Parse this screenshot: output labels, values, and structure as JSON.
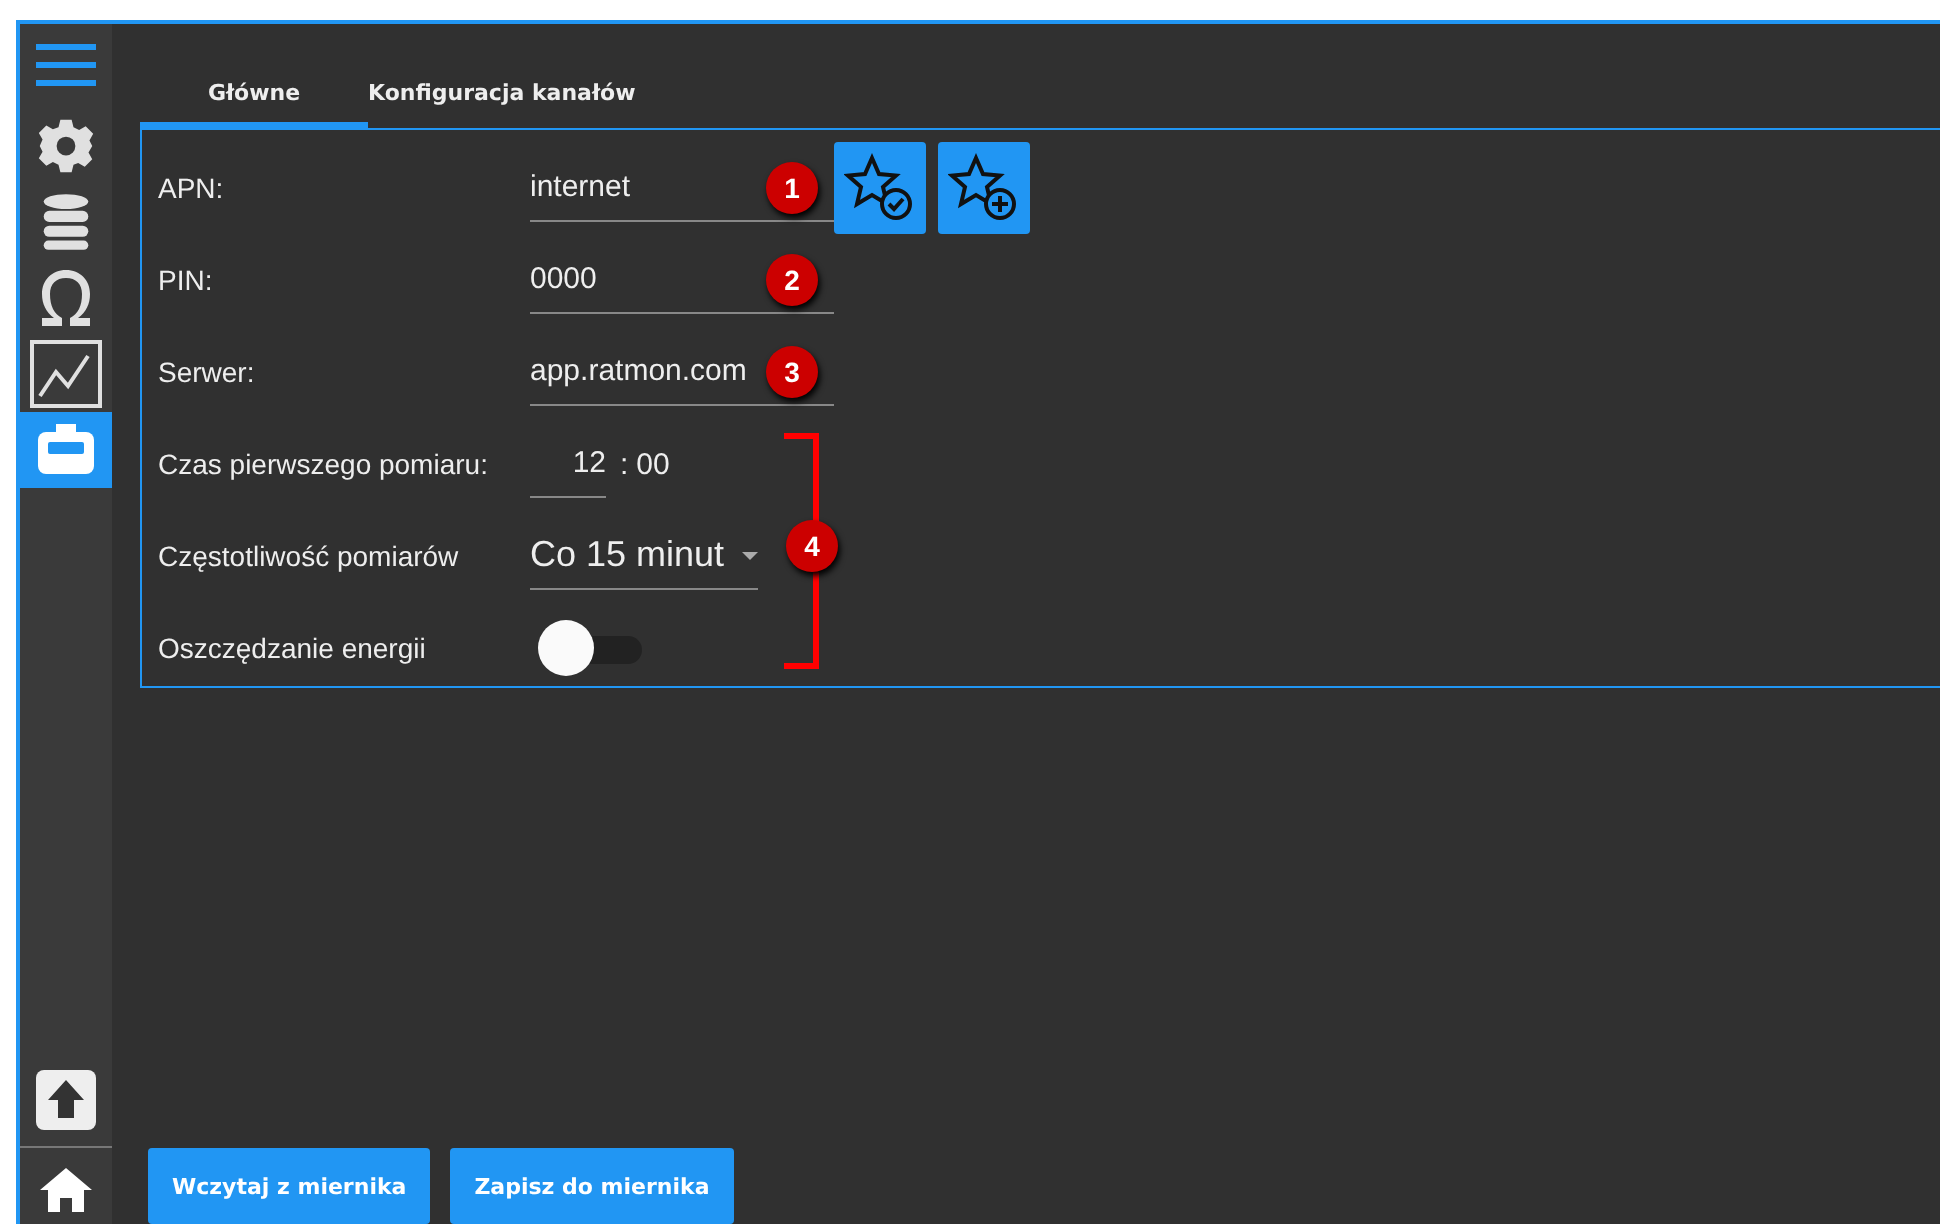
{
  "sidebar": {
    "items": [
      {
        "selected": false
      },
      {
        "selected": false
      },
      {
        "selected": false
      },
      {
        "selected": false
      },
      {
        "selected": true
      }
    ]
  },
  "tabs": [
    {
      "label": "Główne",
      "selected": true
    },
    {
      "label": "Konfiguracja kanałów",
      "selected": false
    }
  ],
  "fields": [
    {
      "kind": "text",
      "label": "APN:",
      "value": "internet",
      "badge": "1"
    },
    {
      "kind": "text",
      "label": "PIN:",
      "value": "0000",
      "badge": "2"
    },
    {
      "kind": "text",
      "label": "Serwer:",
      "value": "app.ratmon.com",
      "badge": "3"
    },
    {
      "kind": "time",
      "label": "Czas pierwszego pomiaru:",
      "hours": "12",
      "separator": ":",
      "minutes": "00"
    },
    {
      "kind": "select",
      "label": "Częstotliwość pomiarów",
      "value": "Co 15 minut"
    },
    {
      "kind": "toggle",
      "label": "Oszczędzanie energii",
      "on": false
    }
  ],
  "group_badge": "4",
  "buttons": [
    "Wczytaj z miernika",
    "Zapisz do miernika"
  ]
}
